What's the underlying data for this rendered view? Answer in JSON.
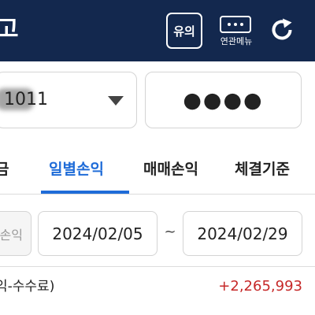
{
  "header": {
    "title": "고",
    "notice_label": "유의",
    "related_menu_label": "연관메뉴",
    "background_color": "#13284e"
  },
  "account": {
    "number_visible": "1011",
    "password_mask": "●●●●"
  },
  "tabs": [
    {
      "label": "금",
      "active": false
    },
    {
      "label": "일별손익",
      "active": true
    },
    {
      "label": "매매손익",
      "active": false
    },
    {
      "label": "체결기준",
      "active": false
    }
  ],
  "filter": {
    "type_label": "손익",
    "start_date": "2024/02/05",
    "separator": "~",
    "end_date": "2024/02/29"
  },
  "summary": {
    "label": "익-수수료)",
    "value": "+2,265,993"
  },
  "colors": {
    "accent": "#1f6cd8",
    "positive": "#c62828"
  },
  "icons": {
    "related": "more-menu-icon",
    "refresh": "refresh-icon",
    "dropdown": "chevron-down-icon"
  }
}
